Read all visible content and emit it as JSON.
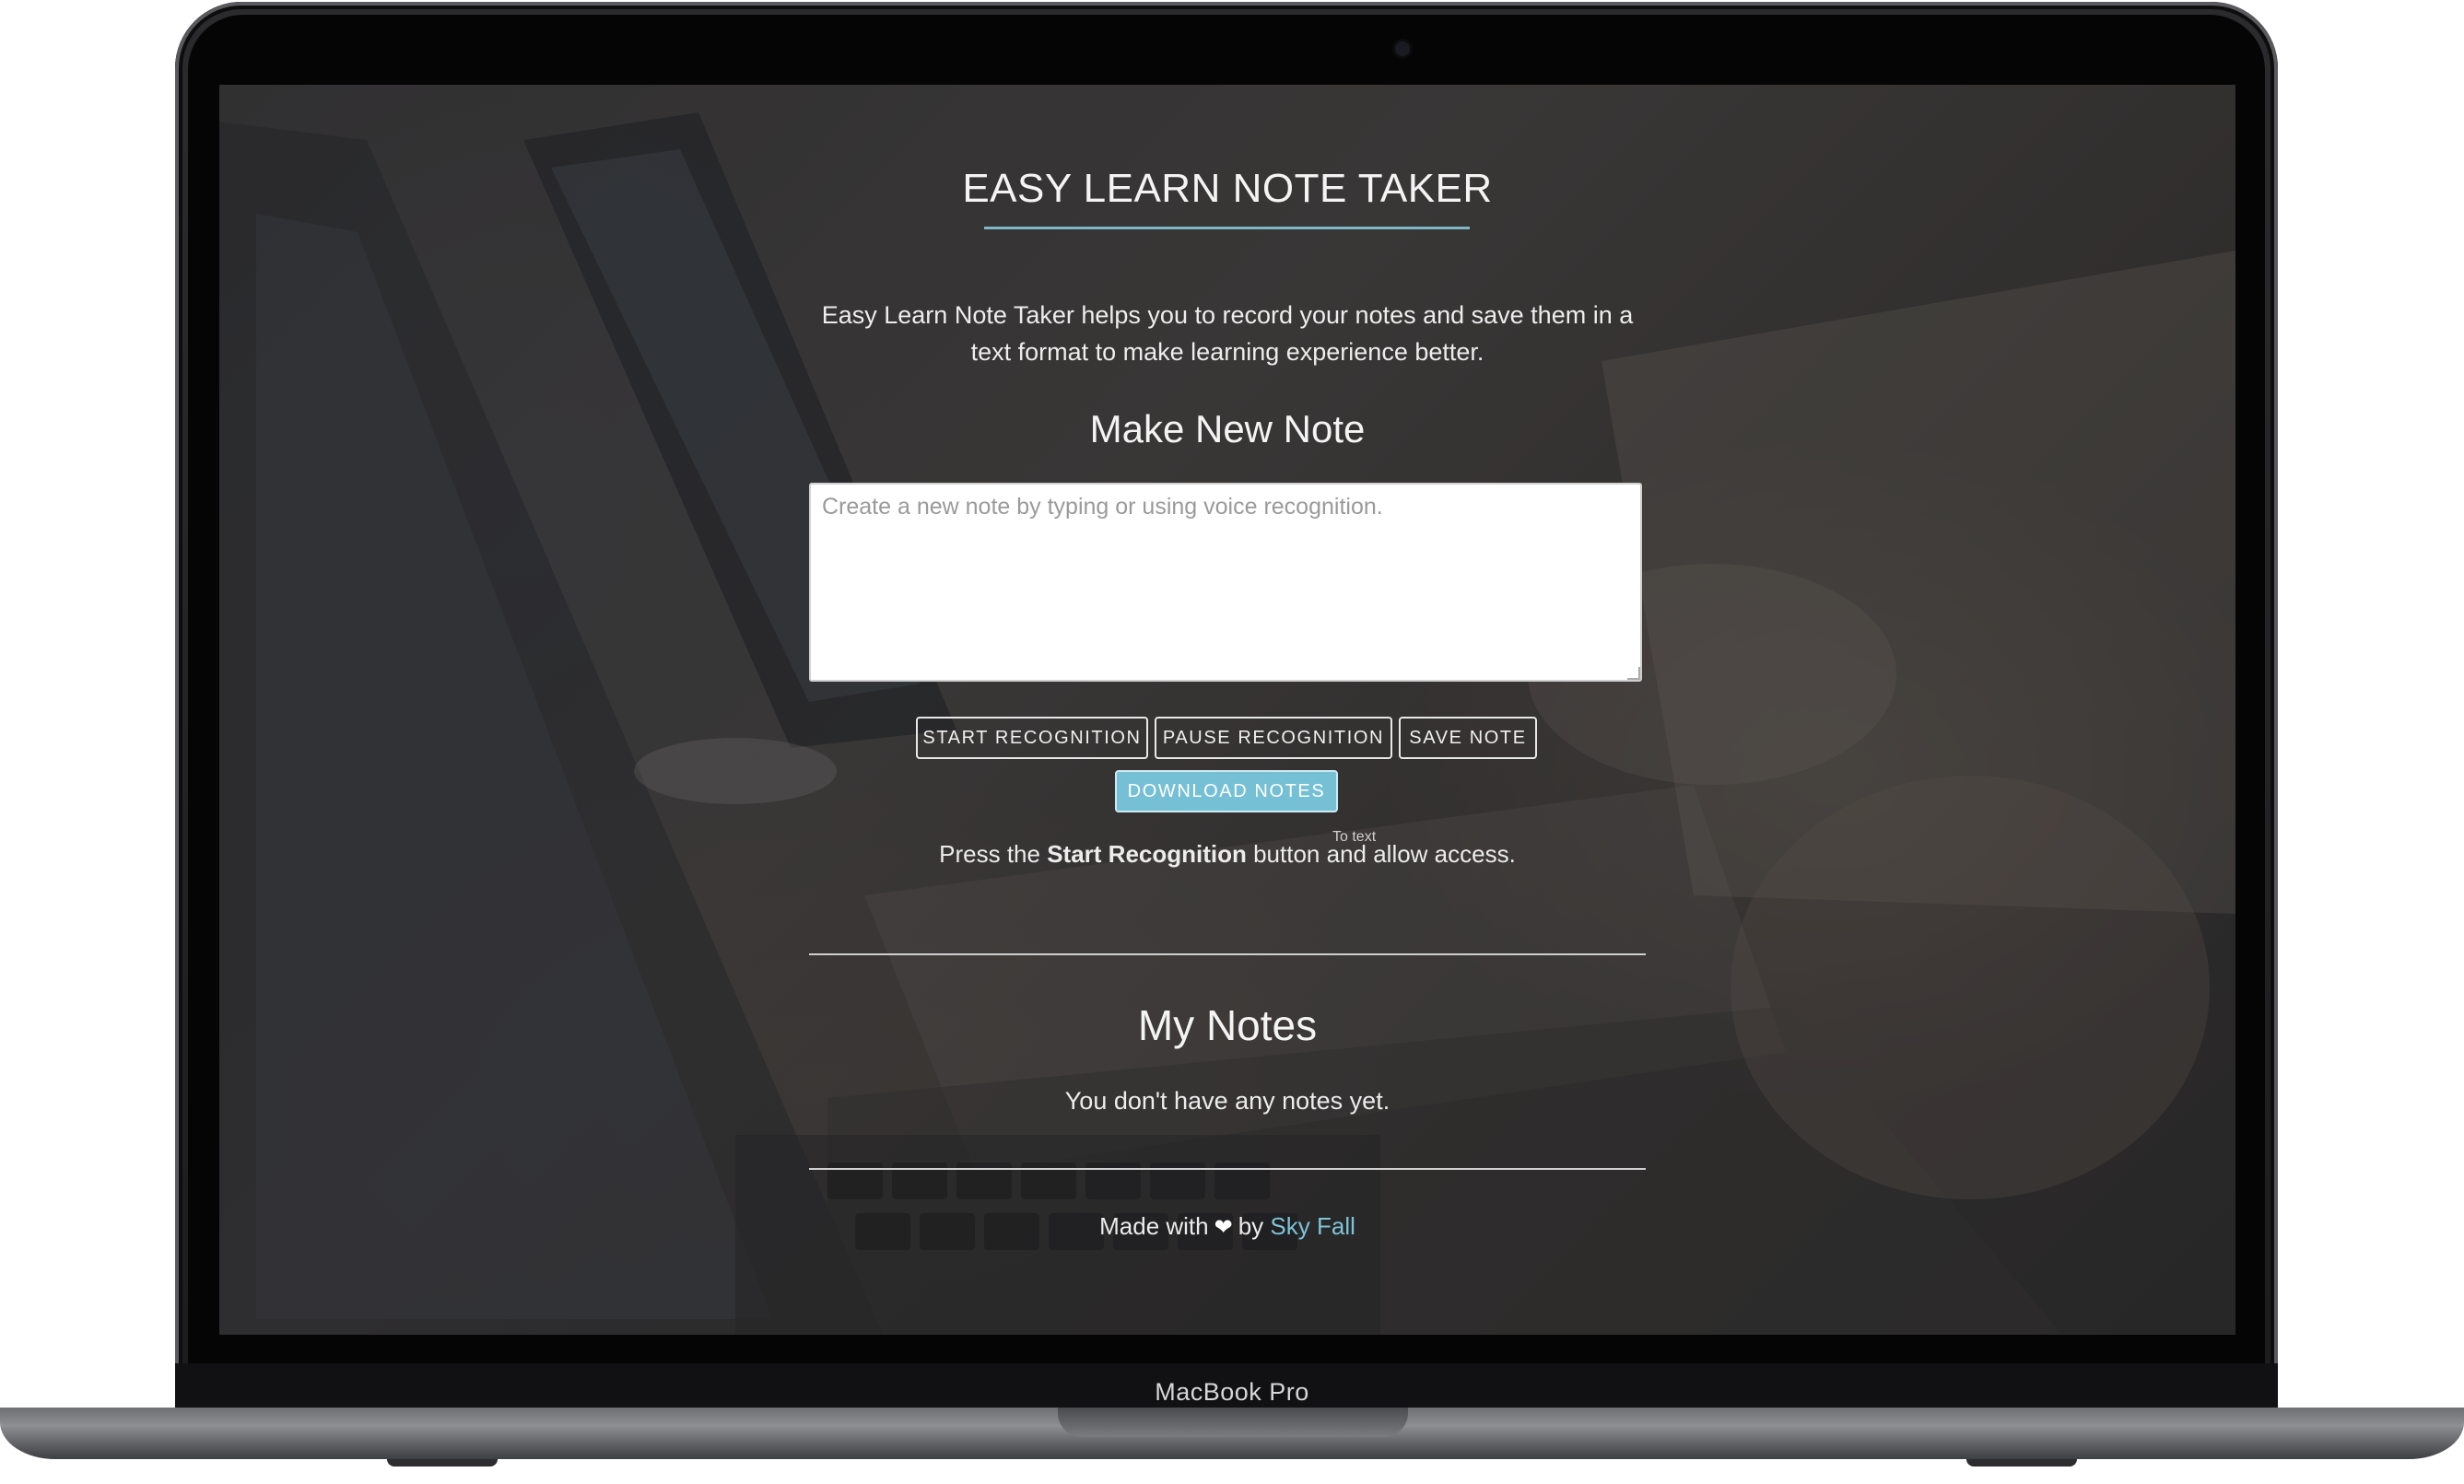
{
  "device": {
    "brand_label": "MacBook Pro"
  },
  "app": {
    "title": "EASY LEARN NOTE TAKER",
    "intro": "Easy Learn Note Taker helps you to record your notes and save them in a text format to make learning experience better.",
    "make_note_heading": "Make New Note",
    "note_placeholder": "Create a new note by typing or using voice recognition.",
    "buttons": {
      "start": "START RECOGNITION",
      "pause": "PAUSE RECOGNITION",
      "save": "SAVE NOTE",
      "download": "DOWNLOAD NOTES"
    },
    "tooltip": "To text",
    "instruction": {
      "before": "Press the ",
      "bold": "Start Recognition",
      "after": " button and allow access."
    },
    "my_notes_heading": "My Notes",
    "empty_message": "You don't have any notes yet.",
    "footer": {
      "made_with": "Made with",
      "heart_icon": "heart-icon",
      "by": "by",
      "author": "Sky Fall"
    }
  },
  "colors": {
    "accent": "#7fb6c6",
    "download_button": "#76c0d6",
    "link": "#7ec3d8"
  }
}
